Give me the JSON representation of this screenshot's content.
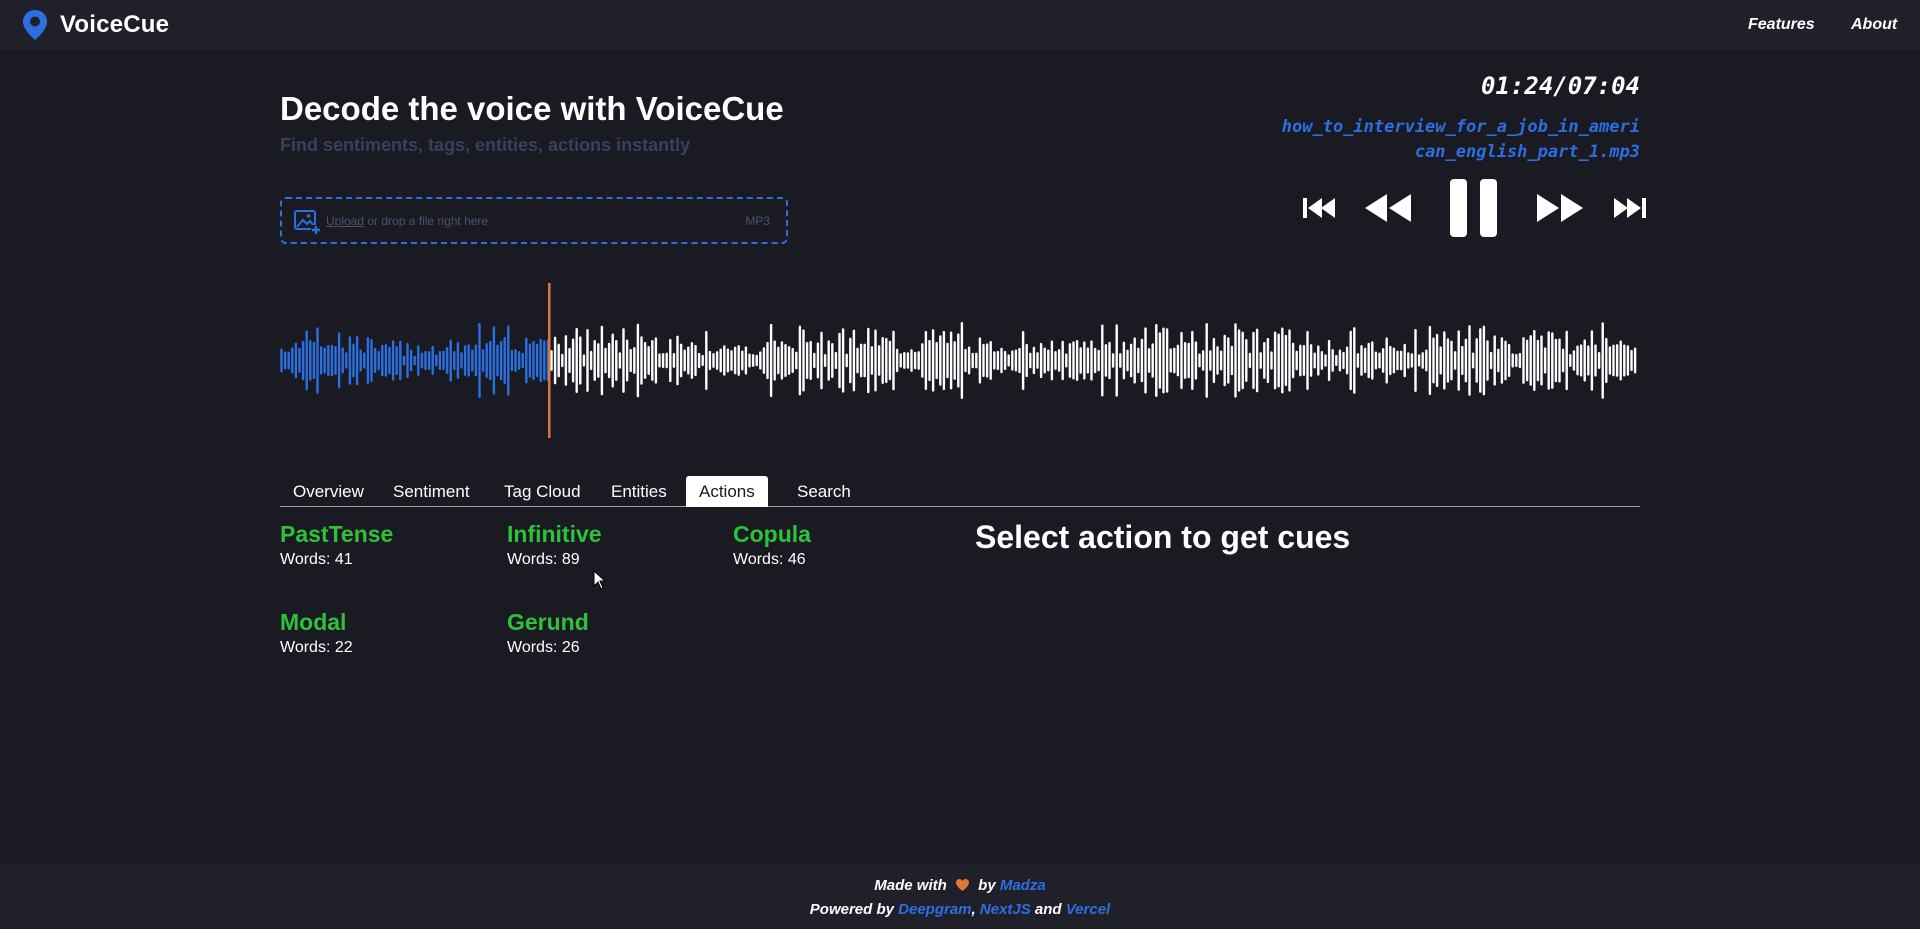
{
  "app": {
    "name": "VoiceCue"
  },
  "nav": {
    "features": "Features",
    "about": "About"
  },
  "hero": {
    "title": "Decode the voice with VoiceCue",
    "subtitle": "Find sentiments, tags, entities, actions instantly"
  },
  "upload": {
    "link": "Upload",
    "text": " or drop a file right here",
    "format": "MP3"
  },
  "player": {
    "time": "01:24/07:04",
    "file_name": "how_to_interview_for_a_job_in_american_english_part_1.mp3",
    "progress": 0.198,
    "controls": [
      "skip-to-start",
      "rewind",
      "pause",
      "fast-forward",
      "skip-to-end"
    ]
  },
  "colors": {
    "accent": "#2b6fe0",
    "action_green": "#2fc13a",
    "playhead": "#e0763a",
    "background": "#1a1a23",
    "bar": "#20202b"
  },
  "tabs": [
    {
      "label": "Overview"
    },
    {
      "label": "Sentiment"
    },
    {
      "label": "Tag Cloud"
    },
    {
      "label": "Entities"
    },
    {
      "label": "Actions",
      "active": true
    },
    {
      "label": "Search"
    }
  ],
  "actions": [
    {
      "name": "PastTense",
      "count": "Words: 41"
    },
    {
      "name": "Infinitive",
      "count": "Words: 89"
    },
    {
      "name": "Copula",
      "count": "Words: 46"
    },
    {
      "name": "Modal",
      "count": "Words: 22"
    },
    {
      "name": "Gerund",
      "count": "Words: 26"
    }
  ],
  "select_prompt": "Select action to get cues",
  "footer": {
    "made_with": "Made with",
    "by": "by",
    "author": "Madza",
    "powered_by": "Powered by",
    "tech_1": "Deepgram",
    "tech_2": "NextJS",
    "and": "and",
    "tech_3": "Vercel"
  }
}
